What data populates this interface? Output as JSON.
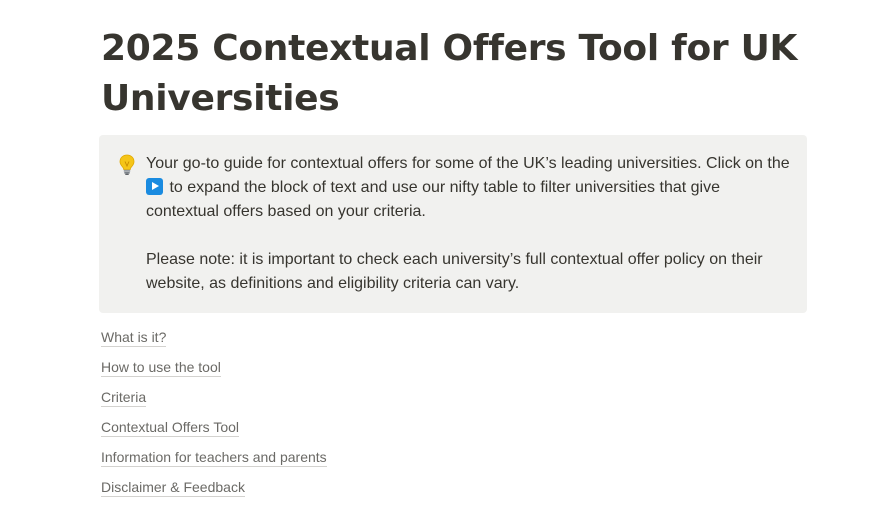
{
  "page": {
    "title": "2025 Contextual Offers Tool for UK Universities"
  },
  "callout": {
    "icon": "lightbulb-icon",
    "text_before_icon": "Your go-to guide for contextual offers for some of the UK’s leading universities. Click on the ",
    "inline_icon": "play-triangle-icon",
    "text_after_icon": " to expand the block of text and use our nifty table to filter universities that give contextual offers based on your criteria.",
    "note": "Please note: it is important to check each university’s full contextual offer policy on their website, as definitions and eligibility criteria can vary."
  },
  "toc": {
    "items": [
      {
        "label": "What is it?"
      },
      {
        "label": "How to use the tool"
      },
      {
        "label": "Criteria"
      },
      {
        "label": "Contextual Offers Tool"
      },
      {
        "label": "Information for teachers and parents"
      },
      {
        "label": "Disclaimer & Feedback"
      }
    ]
  },
  "colors": {
    "text": "#37352f",
    "callout_background": "#f1f1ef",
    "link_text": "#6b6a66",
    "link_underline": "#d3d2cf",
    "play_icon": "#1a8be0",
    "bulb": "#f5c518"
  }
}
